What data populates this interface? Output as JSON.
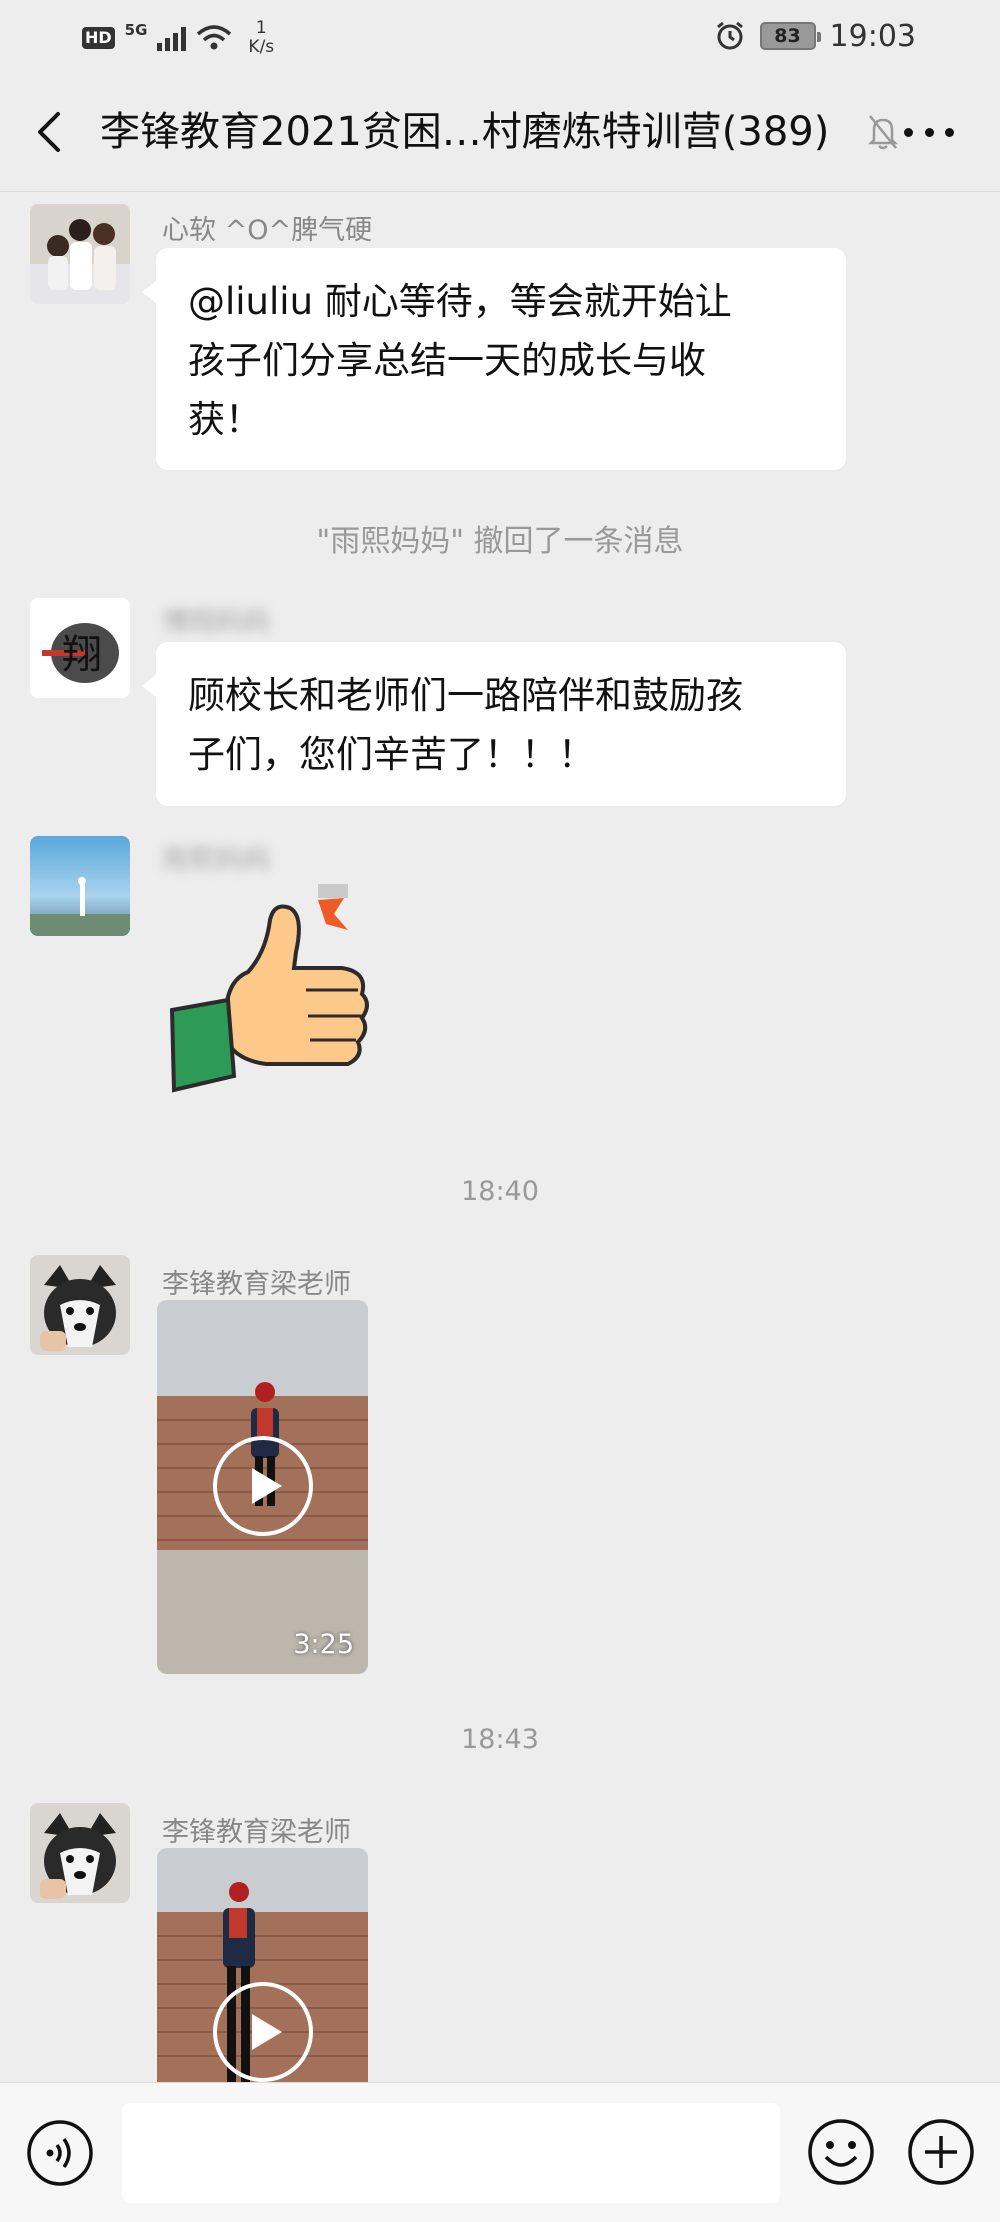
{
  "status_bar": {
    "hd": "HD",
    "network": "5G",
    "speed_value": "1",
    "speed_unit": "K/s",
    "battery": "83",
    "time": "19:03"
  },
  "header": {
    "title": "李锋教育2021贫困…村磨炼特训营(389)",
    "back_icon": "chevron-left-icon",
    "mute_icon": "bell-off-icon",
    "more_icon": "more-dots-icon"
  },
  "messages": {
    "m1": {
      "sender": "心软 ^O^脾气硬",
      "text_line1": "@liuliu 耐心等待，等会就开始让",
      "text_line2": "孩子们分享总结一天的成长与收",
      "text_line3": "获！"
    },
    "recall_notice": "\"雨熙妈妈\" 撤回了一条消息",
    "m2": {
      "sender": "博翔妈妈",
      "avatar_char": "翔",
      "text_line1": "顾校长和老师们一路陪伴和鼓励孩",
      "text_line2": "子们，您们辛苦了！！！"
    },
    "m3": {
      "sender": "雨熙妈妈",
      "sticker": "thumbs-up-icon"
    },
    "time1": "18:40",
    "m4": {
      "sender": "李锋教育梁老师",
      "duration": "3:25"
    },
    "time2": "18:43",
    "m5": {
      "sender": "李锋教育梁老师"
    }
  },
  "input_bar": {
    "voice_icon": "voice-icon",
    "input_value": "",
    "emoji_icon": "emoji-icon",
    "plus_icon": "plus-icon"
  }
}
